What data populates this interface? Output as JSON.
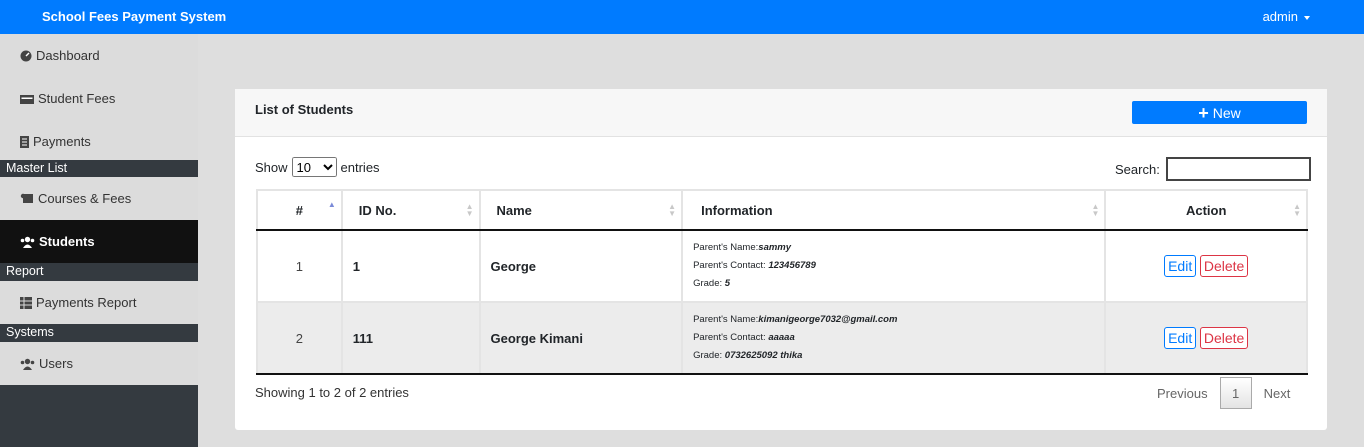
{
  "app": {
    "title": "School Fees Payment System",
    "user": "admin"
  },
  "sidebar": {
    "dashboard": "Dashboard",
    "student_fees": "Student Fees",
    "payments": "Payments",
    "header_master": "Master List",
    "courses": "Courses & Fees",
    "students": "Students",
    "header_report": "Report",
    "payments_report": "Payments Report",
    "header_systems": "Systems",
    "users": "Users"
  },
  "card": {
    "title": "List of Students",
    "new_label": "New"
  },
  "controls": {
    "show": "Show",
    "entries": "entries",
    "page_size": "10",
    "search_label": "Search:"
  },
  "table": {
    "headers": [
      "#",
      "ID No.",
      "Name",
      "Information",
      "Action"
    ],
    "rows": [
      {
        "num": "1",
        "id": "1",
        "name": "George",
        "parent_name_label": "Parent's Name:",
        "parent_name": "sammy",
        "contact_label": "Parent's Contact: ",
        "contact": "123456789",
        "grade_label": "Grade: ",
        "grade": "5"
      },
      {
        "num": "2",
        "id": "111",
        "name": "George Kimani",
        "parent_name_label": "Parent's Name:",
        "parent_name": "kimanigeorge7032@gmail.com",
        "contact_label": "Parent's Contact: ",
        "contact": "aaaaa",
        "grade_label": "Grade: ",
        "grade": "0732625092 thika"
      }
    ],
    "edit": "Edit",
    "delete": "Delete"
  },
  "footer": {
    "info": "Showing 1 to 2 of 2 entries",
    "previous": "Previous",
    "page": "1",
    "next": "Next"
  }
}
